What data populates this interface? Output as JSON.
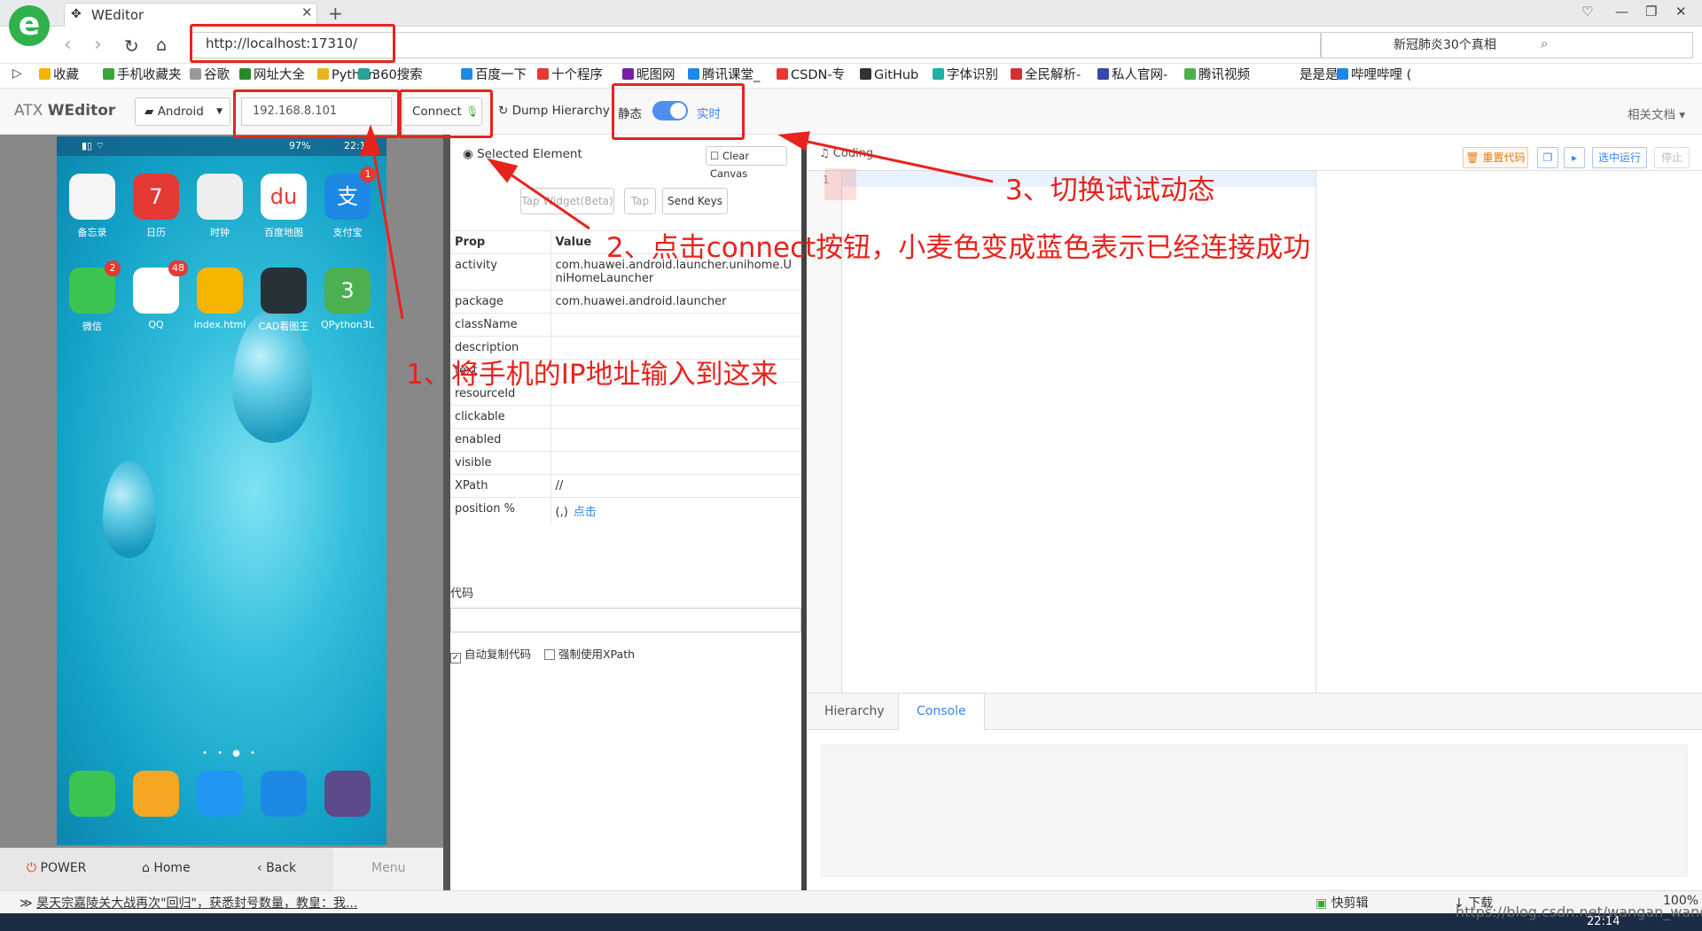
{
  "browser": {
    "tab_title": "WEditor",
    "url": "http://localhost:17310/",
    "right_search": "新冠肺炎30个真相",
    "bookmarks": [
      "收藏",
      "手机收藏夹",
      "谷歌",
      "网址大全",
      "Python",
      "360搜索",
      "百度一下",
      "十个程序",
      "昵图网",
      "腾讯课堂_",
      "CSDN-专",
      "GitHub",
      "字体识别",
      "全民解析-",
      "私人官网-",
      "腾讯视频",
      "是是是",
      "哔哩哔哩 ("
    ]
  },
  "app": {
    "brand_prefix": "ATX",
    "brand_name": "WEditor",
    "platform": "Android",
    "ip_value": "192.168.8.101",
    "connect_label": "Connect",
    "dump_label": "Dump Hierarchy",
    "static_label": "静态",
    "realtime_label": "实时",
    "docs_label": "相关文档"
  },
  "phone": {
    "status_time": "22:14",
    "status_battery": "97%",
    "apps": [
      {
        "label": "备忘录",
        "color": "#f5f5f5"
      },
      {
        "label": "日历",
        "color": "#e53935",
        "glyph": "7"
      },
      {
        "label": "时钟",
        "color": "#eeeeee"
      },
      {
        "label": "百度地图",
        "color": "#ffffff",
        "glyph": "du"
      },
      {
        "label": "支付宝",
        "color": "#1e88e5",
        "glyph": "支",
        "badge": "1"
      },
      {
        "label": "微信",
        "color": "#3cc451",
        "badge": "2"
      },
      {
        "label": "QQ",
        "color": "#ffffff",
        "badge": "48"
      },
      {
        "label": "index.html",
        "color": "#f5b400"
      },
      {
        "label": "CAD看图王",
        "color": "#263238"
      },
      {
        "label": "QPython3L",
        "color": "#4caf50",
        "glyph": "3"
      }
    ],
    "dock_colors": [
      "#3cc451",
      "#f5a623",
      "#2196f3",
      "#1e88e5",
      "#5d4a8a"
    ],
    "buttons": {
      "power": "POWER",
      "home": "Home",
      "back": "Back",
      "menu": "Menu"
    }
  },
  "inspector": {
    "selected_label": "Selected Element",
    "clear_canvas": "Clear Canvas",
    "tap_widget": "Tap Widget(Beta)",
    "tap": "Tap",
    "send_keys": "Send Keys",
    "col_prop": "Prop",
    "col_value": "Value",
    "rows": [
      {
        "prop": "activity",
        "value": "com.huawei.android.launcher.unihome.UniHomeLauncher"
      },
      {
        "prop": "package",
        "value": "com.huawei.android.launcher"
      },
      {
        "prop": "className",
        "value": ""
      },
      {
        "prop": "description",
        "value": ""
      },
      {
        "prop": "text",
        "value": ""
      },
      {
        "prop": "resourceId",
        "value": ""
      },
      {
        "prop": "clickable",
        "value": ""
      },
      {
        "prop": "enabled",
        "value": ""
      },
      {
        "prop": "visible",
        "value": ""
      },
      {
        "prop": "XPath",
        "value": "//"
      },
      {
        "prop": "position %",
        "value": "(,)",
        "link": "点击"
      }
    ],
    "code_label": "代码",
    "auto_copy": "自动复制代码",
    "force_xpath": "强制使用XPath"
  },
  "editor": {
    "coding_label": "Coding",
    "reset_code": "重置代码",
    "run_selected": "选中运行",
    "stop": "停止",
    "line_number": "1",
    "tab_hierarchy": "Hierarchy",
    "tab_console": "Console"
  },
  "statusbar": {
    "news": "昊天宗嘉陵关大战再次\"回归\"，获悉封号数量，教皇：我...",
    "quick_cut": "快剪辑",
    "download": "下载",
    "zoom": "100%",
    "time": "22:14"
  },
  "annotations": {
    "step1": "1、将手机的IP地址输入到这来",
    "step2": "2、点击connect按钮，小麦色变成蓝色表示已经连接成功",
    "step3": "3、切换试试动态",
    "color": "#e8231d"
  },
  "watermark": "https://blog.csdn.net/wangan_wangan"
}
